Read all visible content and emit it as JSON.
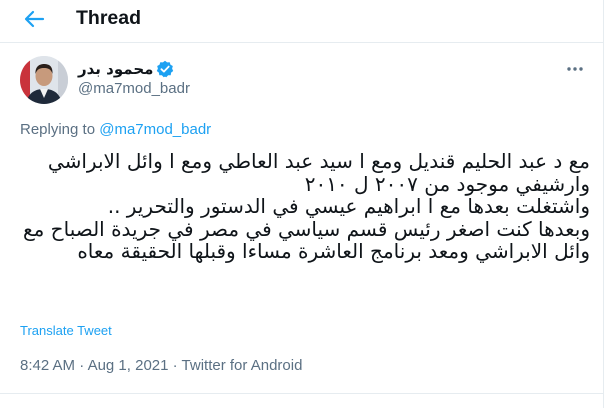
{
  "header": {
    "title": "Thread"
  },
  "tweet": {
    "author_name": "محمود بدر",
    "handle": "@ma7mod_badr",
    "replying_prefix": "Replying to ",
    "replying_to": "@ma7mod_badr",
    "text": "مع د عبد الحليم قنديل ومع ا سيد عبد العاطي ومع ا وائل الابراشي وارشيفي موجود من ٢٠٠٧ ل ٢٠١٠\nواشتغلت بعدها مع ا ابراهيم عيسي في الدستور والتحرير ..\nوبعدها كنت اصغر رئيس قسم سياسي في مصر في جريدة الصباح مع وائل الابراشي ومعد برنامج العاشرة مساءا وقبلها الحقيقة معاه",
    "translate_label": "Translate Tweet",
    "time": "8:42 AM",
    "separator": " · ",
    "date": "Aug 1, 2021",
    "source": "Twitter for Android"
  },
  "colors": {
    "accent": "#1da1f2",
    "secondary_text": "#5b7083",
    "border": "#e6ecf0"
  },
  "icons": {
    "back": "arrow-left-icon",
    "verified": "verified-badge-icon",
    "more": "more-horizontal-icon"
  }
}
